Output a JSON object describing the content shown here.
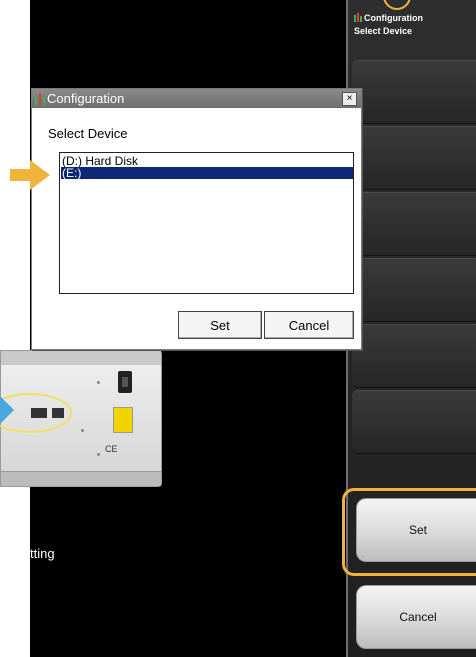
{
  "dialog": {
    "title": "Configuration",
    "label": "Select Device",
    "items": [
      {
        "label": "(D:) Hard Disk",
        "selected": false
      },
      {
        "label": "(E:)",
        "selected": true
      }
    ],
    "set_label": "Set",
    "cancel_label": "Cancel",
    "close_glyph": "×"
  },
  "panel": {
    "title": "Configuration",
    "subtitle": "Select Device",
    "set_label": "Set",
    "cancel_label": "Cancel"
  },
  "background": {
    "caption": "tting"
  },
  "colors": {
    "highlight": "#f0b43c",
    "selection": "#0d2877",
    "callout_blue": "#49a7e0"
  }
}
